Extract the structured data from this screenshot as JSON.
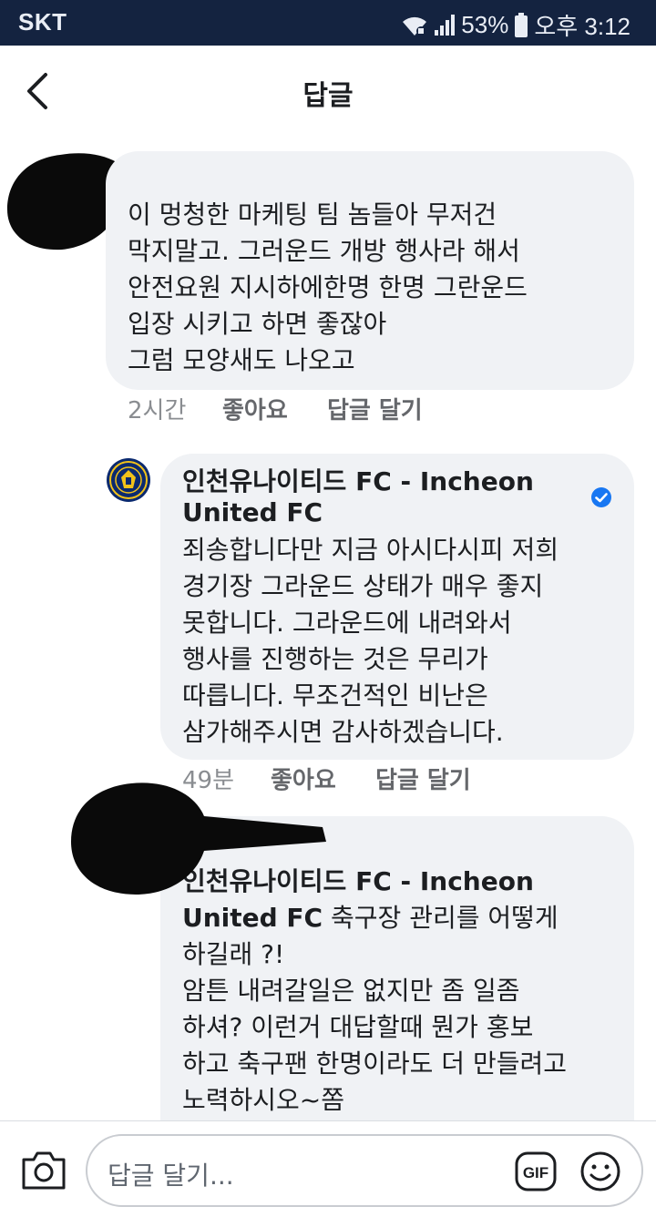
{
  "status_bar": {
    "carrier": "SKT",
    "battery": "53%",
    "time": "오후 3:12"
  },
  "header": {
    "title": "답글",
    "back_icon": "chevron-left-icon"
  },
  "comments": [
    {
      "author": "",
      "text": "이 멍청한 마케팅 팀 놈들아 무저건\n막지말고. 그러운드 개방 행사라 해서\n안전요원 지시하에한명 한명 그란운드\n입장 시키고 하면 좋잖아\n그럼 모양새도 나오고",
      "time": "2시간",
      "like_label": "좋아요",
      "reply_label": "답글 달기"
    },
    {
      "author": "인천유나이티드 FC - Incheon United FC",
      "verified": true,
      "text": "죄송합니다만 지금 아시다시피 저희\n경기장 그라운드 상태가 매우 좋지\n못합니다. 그라운드에 내려와서\n행사를 진행하는 것은 무리가\n따릅니다. 무조건적인 비난은\n삼가해주시면 감사하겠습니다.",
      "time": "49분",
      "like_label": "좋아요",
      "reply_label": "답글 달기"
    },
    {
      "author": "",
      "mention": "인천유나이티드 FC - Incheon\nUnited FC",
      "text": " 축구장 관리를 어떻게\n하길래 ?!\n암튼 내려갈일은 없지만 좀 일좀\n하셔? 이런거 대답할때 뭔가 홍보\n하고 축구팬 한명이라도 더 만들려고\n노력하시오~쫌"
    }
  ],
  "composer": {
    "placeholder": "답글 달기...",
    "gif_label": "GIF",
    "camera_icon": "camera-icon",
    "emoji_icon": "smiley-icon"
  },
  "colors": {
    "status_bar_bg": "#142340",
    "bubble_bg": "#f0f2f5",
    "verified_blue": "#1877f2",
    "meta_gray": "#65676b"
  }
}
